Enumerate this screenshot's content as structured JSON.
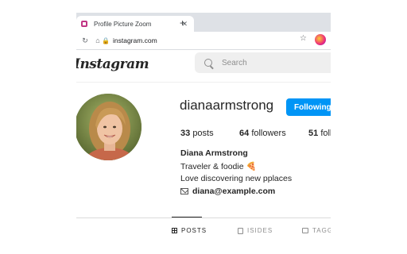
{
  "browser": {
    "tab_title": "Profile Picture Zoom",
    "tab_close": "✕",
    "new_tab": "+",
    "url": "instagram.com",
    "nav_icons": [
      "back-icon",
      "forward-icon",
      "reload-icon",
      "home-icon"
    ]
  },
  "header": {
    "logo": "Instagram",
    "search_placeholder": "Search"
  },
  "profile": {
    "username": "dianaarmstrong",
    "follow_label": "Following",
    "posts_count": "33",
    "posts_label": "posts",
    "followers_count": "64",
    "followers_label": "followers",
    "following_count": "51",
    "following_label": "following",
    "full_name": "Diana Armstrong",
    "bio_line1": "Traveler & foodie 🍕",
    "bio_line2": "Love discovering new pplaces",
    "email": "diana@example.com"
  },
  "tabs": [
    {
      "label": "POSTS"
    },
    {
      "label": "ISIDES"
    },
    {
      "label": "TAGGED"
    }
  ],
  "colors": {
    "accent": "#0095f6",
    "text": "#262626"
  }
}
